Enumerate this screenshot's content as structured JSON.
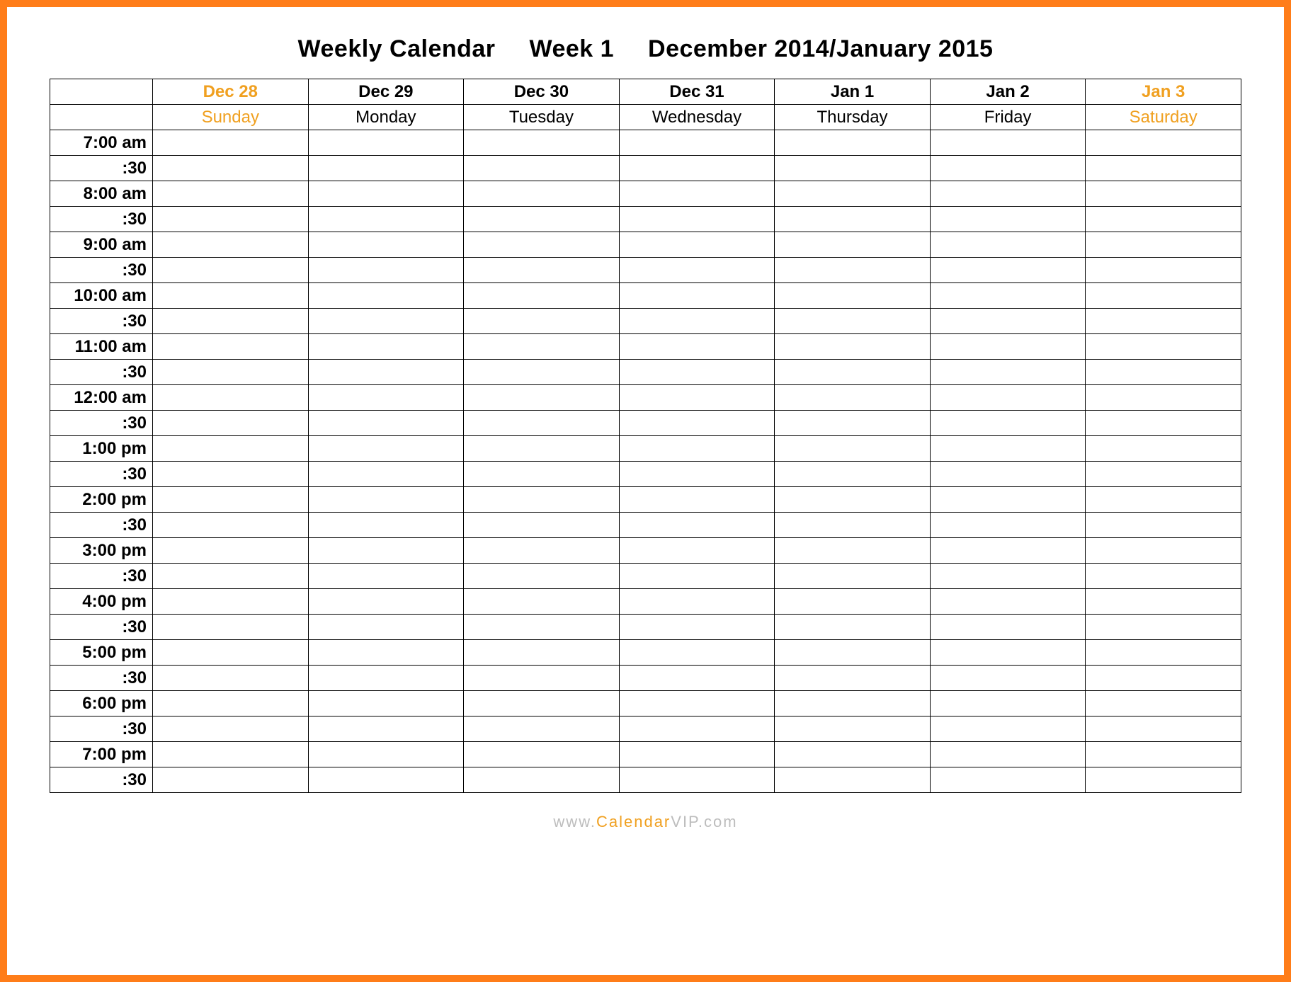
{
  "title": {
    "seg1": "Weekly Calendar",
    "seg2": "Week 1",
    "seg3": "December 2014/January 2015"
  },
  "days": [
    {
      "date": "Dec 28",
      "name": "Sunday",
      "weekend": true
    },
    {
      "date": "Dec 29",
      "name": "Monday",
      "weekend": false
    },
    {
      "date": "Dec 30",
      "name": "Tuesday",
      "weekend": false
    },
    {
      "date": "Dec 31",
      "name": "Wednesday",
      "weekend": false
    },
    {
      "date": "Jan 1",
      "name": "Thursday",
      "weekend": false
    },
    {
      "date": "Jan 2",
      "name": "Friday",
      "weekend": false
    },
    {
      "date": "Jan 3",
      "name": "Saturday",
      "weekend": true
    }
  ],
  "times": [
    "7:00 am",
    ":30",
    "8:00 am",
    ":30",
    "9:00 am",
    ":30",
    "10:00 am",
    ":30",
    "11:00 am",
    ":30",
    "12:00 am",
    ":30",
    "1:00 pm",
    ":30",
    "2:00 pm",
    ":30",
    "3:00 pm",
    ":30",
    "4:00 pm",
    ":30",
    "5:00 pm",
    ":30",
    "6:00 pm",
    ":30",
    "7:00 pm",
    ":30"
  ],
  "footer": {
    "prefix": "www.",
    "brand1": "Calendar",
    "brand2": "VIP",
    "suffix": ".com"
  },
  "colors": {
    "border": "#ff7d19",
    "weekend": "#f0a020"
  }
}
